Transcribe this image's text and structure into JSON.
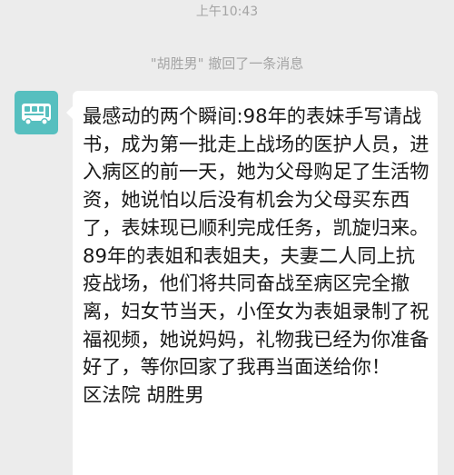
{
  "status": {
    "time": "上午10:43"
  },
  "notice": {
    "recall_text": "\"胡胜男\" 撤回了一条消息"
  },
  "avatar": {
    "icon": "bus-icon",
    "background": "#56bfbf"
  },
  "message": {
    "text": "最感动的两个瞬间:98年的表妹手写请战书，成为第一批走上战场的医护人员，进入病区的前一天，她为父母购足了生活物资，她说怕以后没有机会为父母买东西了，表妹现已顺利完成任务，凯旋归来。89年的表姐和表姐夫，夫妻二人同上抗疫战场，他们将共同奋战至病区完全撤离，妇女节当天，小侄女为表姐录制了祝福视频，她说妈妈，礼物我已经为你准备好了，等你回家了我再当面送给你！\n区法院  胡胜男"
  }
}
